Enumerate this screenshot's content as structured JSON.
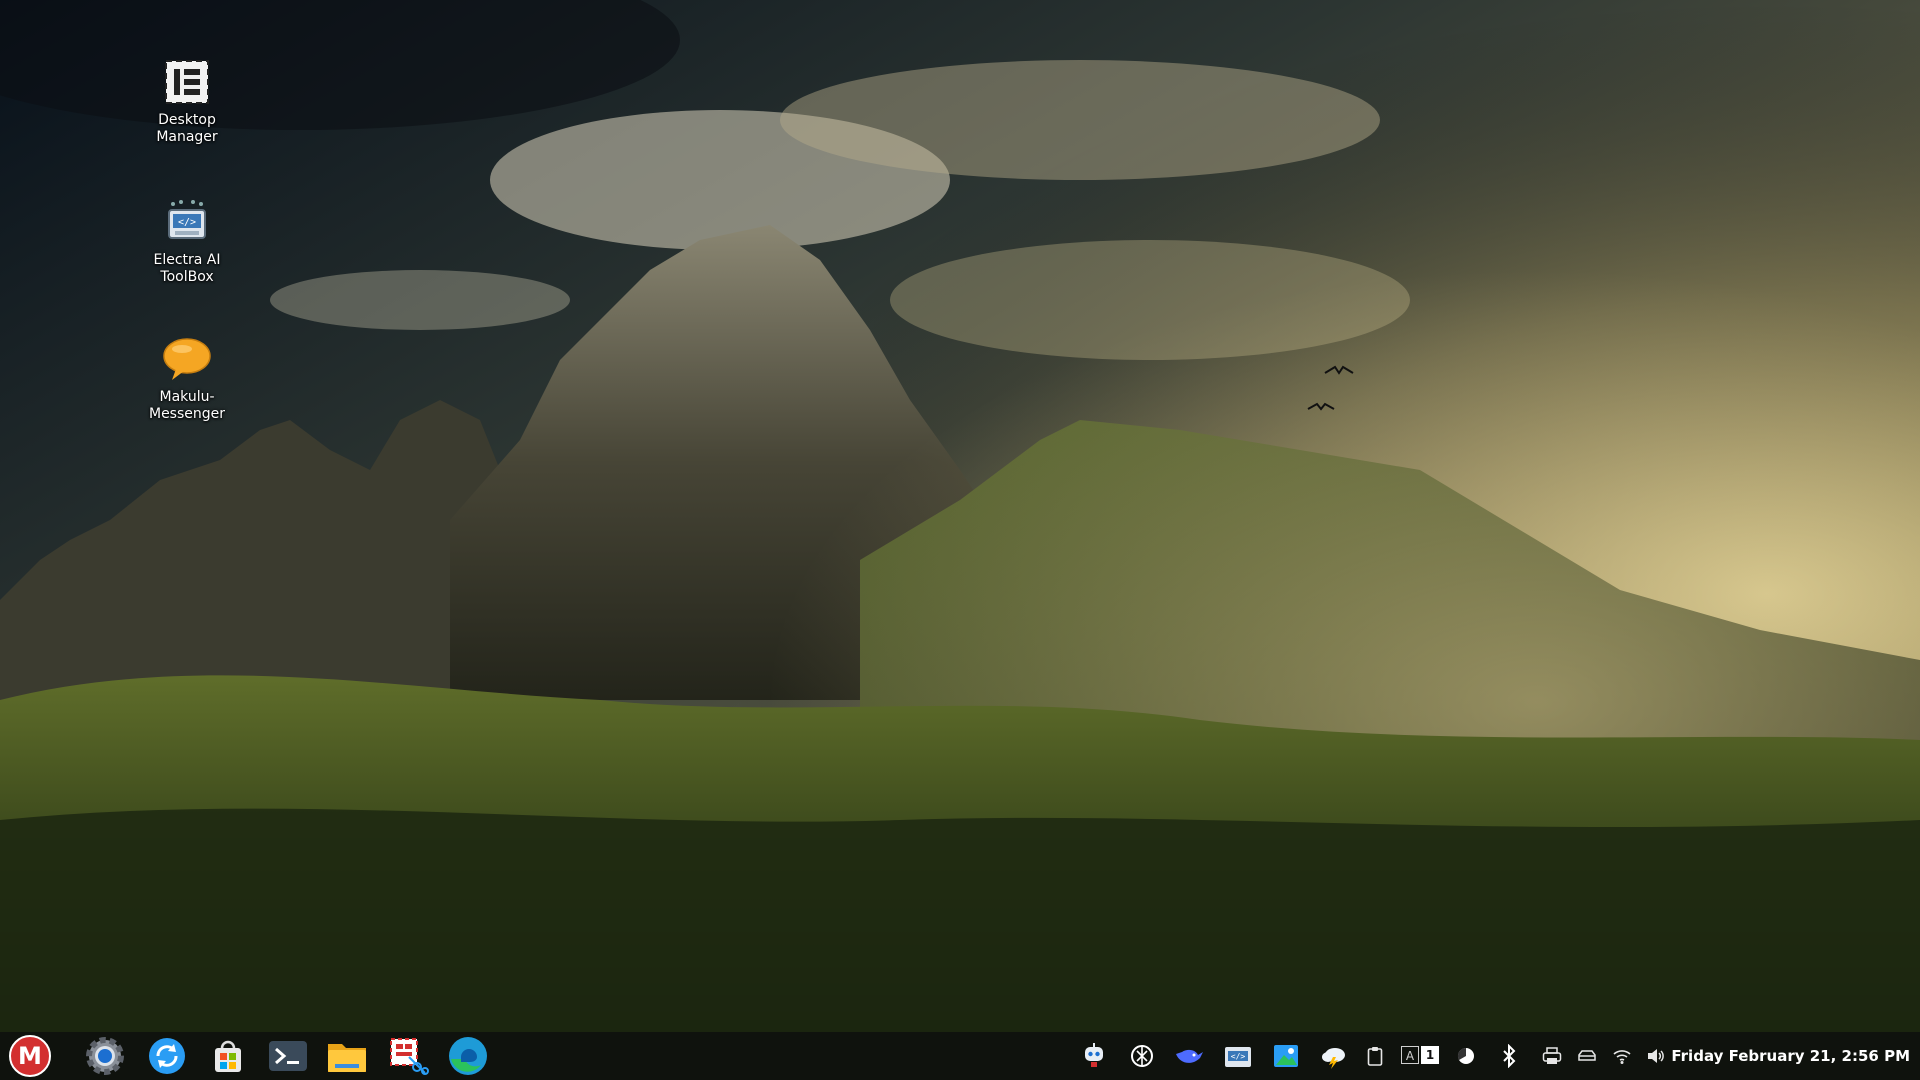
{
  "desktop": {
    "icons": [
      {
        "label": "Desktop\nManager",
        "icon": "desktop-manager-icon"
      },
      {
        "label": "Electra AI\nToolBox",
        "icon": "ai-toolbox-icon"
      },
      {
        "label": "Makulu-\nMessenger",
        "icon": "chat-bubble-icon"
      }
    ]
  },
  "taskbar": {
    "start": {
      "icon": "makulu-start-icon",
      "letter": "M",
      "color": "#d32f2f"
    },
    "apps": [
      {
        "icon": "settings-gear-icon"
      },
      {
        "icon": "update-sync-icon"
      },
      {
        "icon": "software-store-icon"
      },
      {
        "icon": "terminal-icon"
      },
      {
        "icon": "file-manager-icon"
      },
      {
        "icon": "screenshot-tool-icon"
      },
      {
        "icon": "edge-browser-icon"
      }
    ],
    "tray": [
      {
        "icon": "assistant-robot-icon"
      },
      {
        "icon": "openai-icon"
      },
      {
        "icon": "deepseek-whale-icon"
      },
      {
        "icon": "code-editor-icon"
      },
      {
        "icon": "image-viewer-icon"
      },
      {
        "icon": "weather-icon"
      },
      {
        "icon": "clipboard-icon"
      },
      {
        "icon": "keyboard-layout-icon"
      },
      {
        "icon": "power-manager-icon"
      },
      {
        "icon": "bluetooth-icon"
      },
      {
        "icon": "printer-icon"
      },
      {
        "icon": "drive-icon"
      },
      {
        "icon": "wifi-icon"
      },
      {
        "icon": "volume-icon"
      }
    ],
    "keyboard_layout": {
      "a": "A",
      "b": "1"
    },
    "clock": "Friday February 21,  2:56 PM"
  },
  "colors": {
    "taskbar_bg": "#0c0e0c",
    "accent_red": "#d32f2f",
    "accent_blue": "#2a9df4"
  }
}
